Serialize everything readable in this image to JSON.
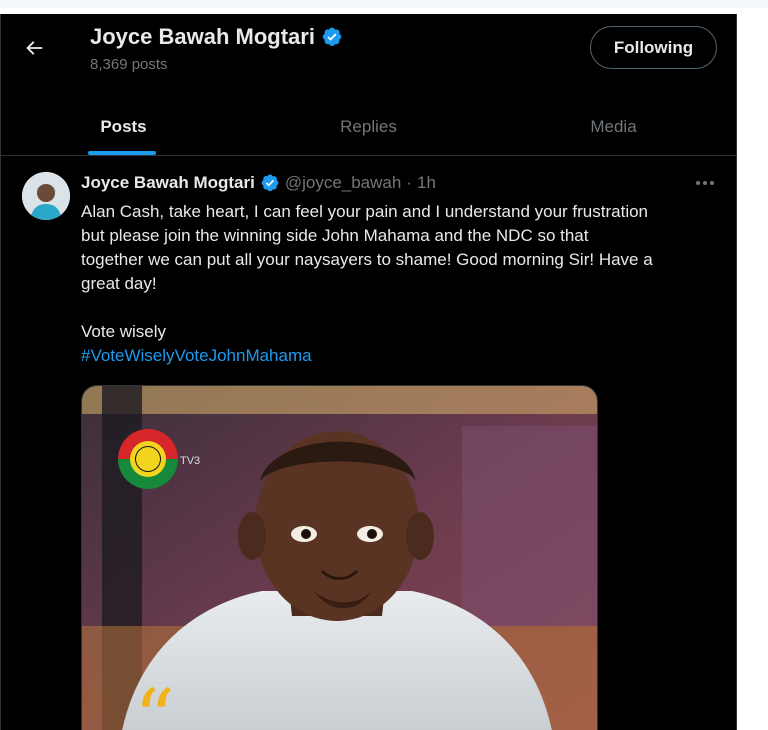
{
  "profile": {
    "name": "Joyce Bawah Mogtari",
    "posts_count": "8,369 posts",
    "follow_label": "Following"
  },
  "tabs": [
    {
      "label": "Posts",
      "active": true
    },
    {
      "label": "Replies",
      "active": false
    },
    {
      "label": "Media",
      "active": false
    }
  ],
  "post": {
    "author": "Joyce Bawah Mogtari",
    "handle": "@joyce_bawah",
    "separator": "·",
    "time": "1h",
    "lines": [
      "Alan Cash, take heart, I can feel your pain and I understand your frustration",
      "but please join the winning side John Mahama and the NDC so that",
      "together we can put all your naysayers to shame! Good morning Sir! Have a",
      "great day!"
    ],
    "line2": "Vote wisely",
    "hashtag": "#VoteWiselyVoteJohnMahama",
    "media_logo_text": "TV3"
  },
  "colors": {
    "background": "#000000",
    "text_primary": "#e7e9ea",
    "text_secondary": "#71767b",
    "accent": "#1d9bf0",
    "border": "#2f3336"
  },
  "icons": [
    "back-arrow-icon",
    "verified-badge-icon",
    "more-options-icon"
  ]
}
